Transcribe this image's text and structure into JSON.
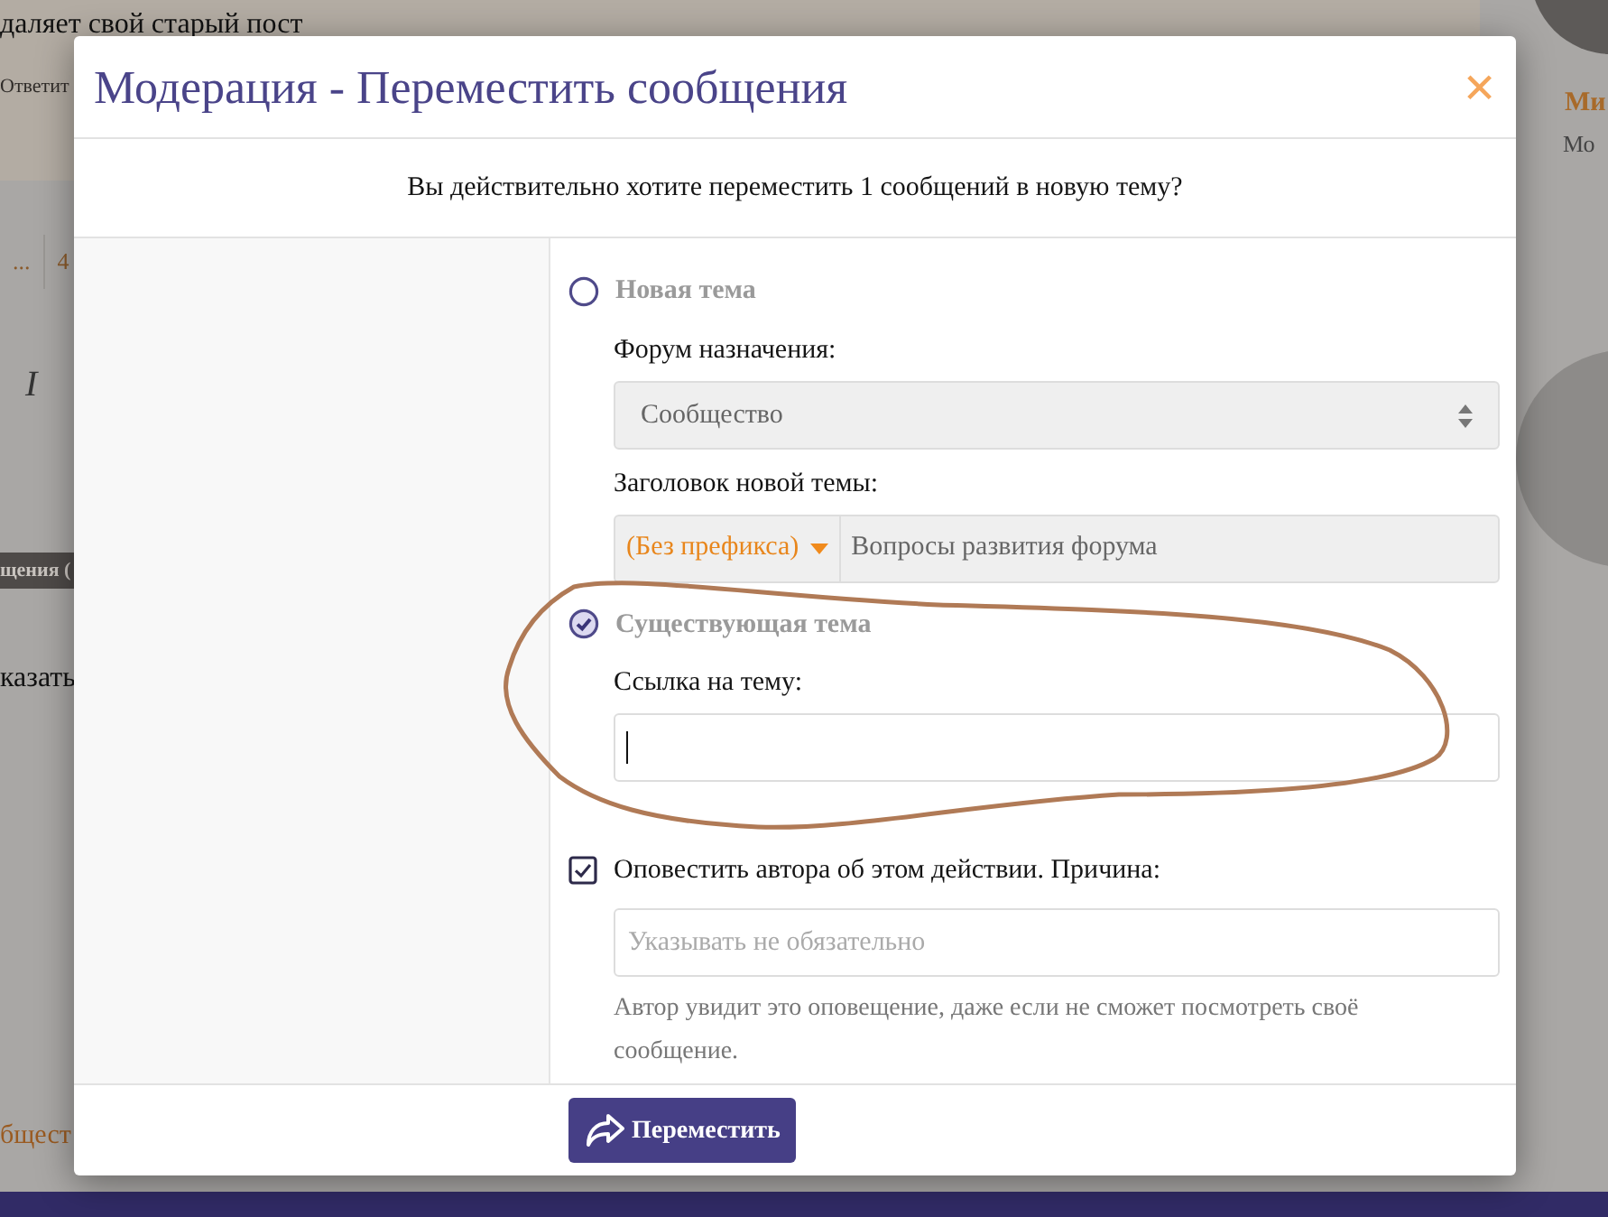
{
  "background_page": {
    "post_text": "даляет свой старый пост",
    "reply_link": "Ответит",
    "pagination": [
      "...",
      "4"
    ],
    "italic_button": "I",
    "thread_title_bar": "щения (",
    "show_text": "казать",
    "forum_link": "бщест",
    "user_name": "Ми",
    "user_role": "Мо"
  },
  "modal": {
    "title": "Модерация - Переместить сообщения",
    "close": "×",
    "question": "Вы действительно хотите переместить 1 сообщений в новую тему?",
    "options": [
      {
        "label": "Новая тема",
        "selected": false
      },
      {
        "label": "Существующая тема",
        "selected": true
      }
    ],
    "forum_label": "Форум назначения:",
    "forum_value": "Сообщество",
    "title_label": "Заголовок новой темы:",
    "prefix": "(Без префикса)",
    "title_value": "Вопросы развития форума",
    "link_label": "Ссылка на тему:",
    "notify": {
      "label": "Оповестить автора об этом действии. Причина:",
      "checked": true
    },
    "reason_placeholder": "Указывать не обязательно",
    "help": "Автор увидит это оповещение, даже если не сможет посмотреть своё сообщение.",
    "submit": "Переместить"
  }
}
